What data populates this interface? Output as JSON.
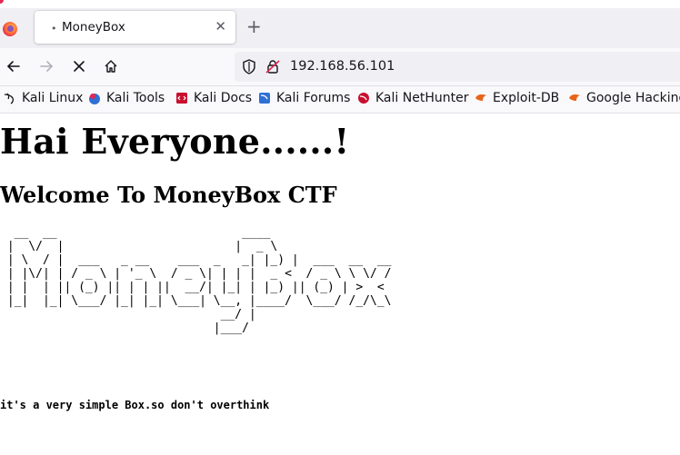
{
  "tab": {
    "title": "MoneyBox",
    "close": "✕"
  },
  "newtab": "+",
  "address": {
    "url": "192.168.56.101"
  },
  "bookmarks": [
    {
      "label": "Kali Linux",
      "icon": "kali-dragon-icon"
    },
    {
      "label": "Kali Tools",
      "icon": "kali-tools-icon"
    },
    {
      "label": "Kali Docs",
      "icon": "kali-docs-icon"
    },
    {
      "label": "Kali Forums",
      "icon": "kali-forums-icon"
    },
    {
      "label": "Kali NetHunter",
      "icon": "kali-nethunter-icon"
    },
    {
      "label": "Exploit-DB",
      "icon": "exploit-db-icon"
    },
    {
      "label": "Google Hacking",
      "icon": "google-hacking-icon"
    }
  ],
  "page": {
    "heading": "Hai Everyone......!",
    "subheading": "Welcome To MoneyBox CTF",
    "ascii_art": "  __  __                          ____            \n |  \\/  |                        |  _ \\           \n | \\  / |  ___   _ __    ___  _   _| |_) |  ___  __  __\n | |\\/| | / _ \\ | '_ \\  / _ \\| | | |  _ <  / _ \\ \\ \\/ /\n | |  | || (_) || | | ||  __/| |_| | |_) || (_) | >  < \n |_|  |_| \\___/ |_| |_| \\___| \\__, |____/  \\___/ /_/\\_\\\n                               __/ |                 \n                              |___/                  ",
    "note": "it's a very simple Box.so don't overthink"
  },
  "colors": {
    "tabbar_bg": "#f0f0f4",
    "toolbar_bg": "#f9f9fb",
    "text": "#15141a"
  }
}
